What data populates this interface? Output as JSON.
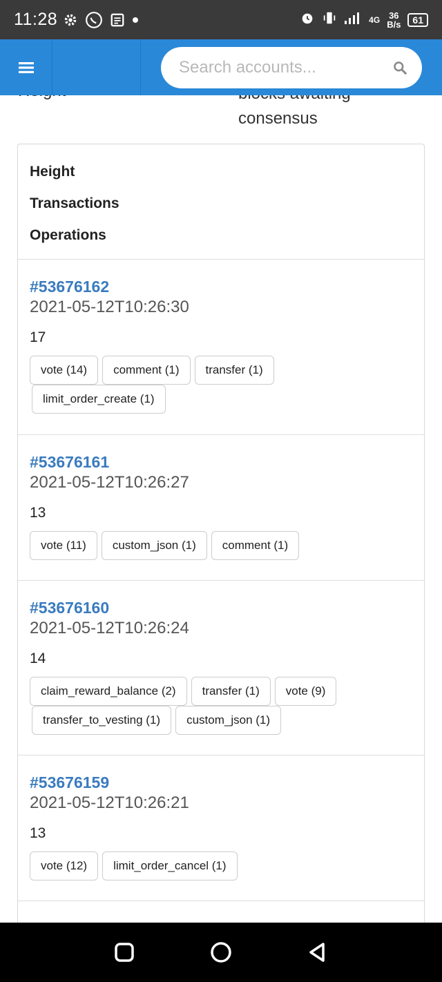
{
  "status_bar": {
    "time": "11:28",
    "net_type": "4G",
    "speed_value": "36",
    "speed_unit": "B/s",
    "battery": "61"
  },
  "header": {
    "search_placeholder": "Search accounts..."
  },
  "partial": {
    "left": "Height",
    "right_line1": "blocks awaiting",
    "right_line2": "consensus"
  },
  "card": {
    "headers": [
      "Height",
      "Transactions",
      "Operations"
    ],
    "blocks": [
      {
        "number": "#53676162",
        "timestamp": "2021-05-12T10:26:30",
        "transactions": "17",
        "ops": [
          "vote (14)",
          "comment (1)",
          "transfer (1)",
          "limit_order_create (1)"
        ]
      },
      {
        "number": "#53676161",
        "timestamp": "2021-05-12T10:26:27",
        "transactions": "13",
        "ops": [
          "vote (11)",
          "custom_json (1)",
          "comment (1)"
        ]
      },
      {
        "number": "#53676160",
        "timestamp": "2021-05-12T10:26:24",
        "transactions": "14",
        "ops": [
          "claim_reward_balance (2)",
          "transfer (1)",
          "vote (9)",
          "transfer_to_vesting (1)",
          "custom_json (1)"
        ]
      },
      {
        "number": "#53676159",
        "timestamp": "2021-05-12T10:26:21",
        "transactions": "13",
        "ops": [
          "vote (12)",
          "limit_order_cancel (1)"
        ]
      }
    ]
  },
  "colors": {
    "appbar": "#2a88d8",
    "link": "#3a7bbf",
    "statusbar": "#3a3a3a"
  },
  "icons": {
    "menu": "hamburger-icon",
    "search": "search-icon",
    "nav": [
      "recents-square-icon",
      "home-circle-icon",
      "back-triangle-icon"
    ]
  }
}
